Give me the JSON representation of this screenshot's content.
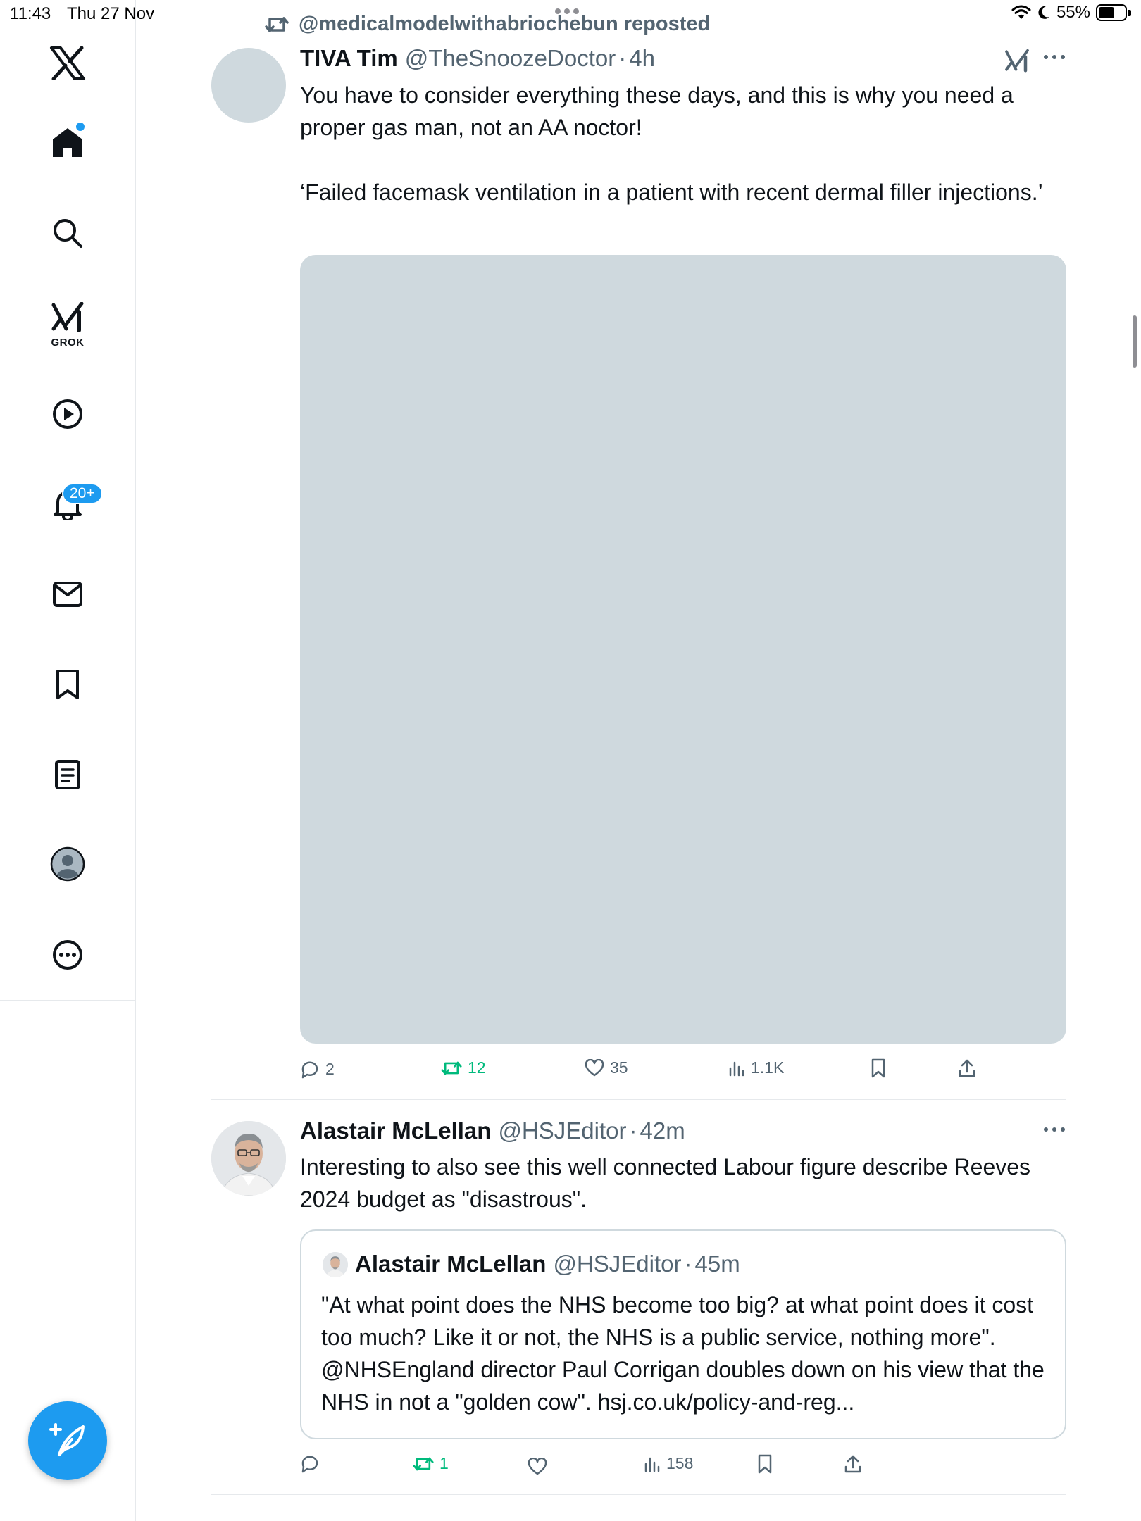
{
  "status_bar": {
    "time": "11:43",
    "date": "Thu 27 Nov",
    "battery": "55%",
    "battery_level": 0.55
  },
  "sidebar": {
    "items": [
      {
        "name": "x-logo",
        "interactable": true
      },
      {
        "name": "home-icon"
      },
      {
        "name": "search-icon"
      },
      {
        "name": "grok-icon",
        "label": "GROK"
      },
      {
        "name": "video-icon"
      },
      {
        "name": "notifications-icon",
        "badge": "20+"
      },
      {
        "name": "messages-icon"
      },
      {
        "name": "bookmarks-icon"
      },
      {
        "name": "lists-icon"
      },
      {
        "name": "profile-icon"
      },
      {
        "name": "more-icon"
      }
    ],
    "grok_label": "GROK",
    "notifications_badge": "20+",
    "compose_icon": "feather-plus-icon"
  },
  "feed": {
    "post1": {
      "repost_label": "@medicalmodelwithabriochebun reposted",
      "name": "TIVA Tim",
      "handle": "@TheSnoozeDoctor",
      "separator": "·",
      "time": "4h",
      "text_p1": "You have to consider everything these days, and this is why you need a proper gas man, not an AA noctor!",
      "text_p2": "‘Failed facemask ventilation in a patient with recent dermal filler injections.’",
      "stats": {
        "replies": "2",
        "reposts": "12",
        "likes": "35",
        "views": "1.1K"
      }
    },
    "post2": {
      "name": "Alastair McLellan",
      "handle": "@HSJEditor",
      "separator": "·",
      "time": "42m",
      "text": "Interesting to also see this well connected Labour figure describe Reeves 2024 budget as \"disastrous\".",
      "quote": {
        "name": "Alastair McLellan",
        "handle": "@HSJEditor",
        "separator": "·",
        "time": "45m",
        "text": "\"At what point does the NHS become too big? at what point does it cost too much? Like it or not, the NHS is a public service, nothing more\". @NHSEngland director Paul Corrigan doubles down on his view that the NHS in not a \"golden cow\". hsj.co.uk/policy-and-reg..."
      },
      "stats": {
        "replies": "",
        "reposts": "1",
        "likes": "",
        "views": "158"
      }
    }
  },
  "colors": {
    "accent": "#1d9bf0",
    "text": "#0f1419",
    "muted": "#536471",
    "repost_green": "#00ba7c",
    "media_placeholder": "#cfd9de"
  }
}
